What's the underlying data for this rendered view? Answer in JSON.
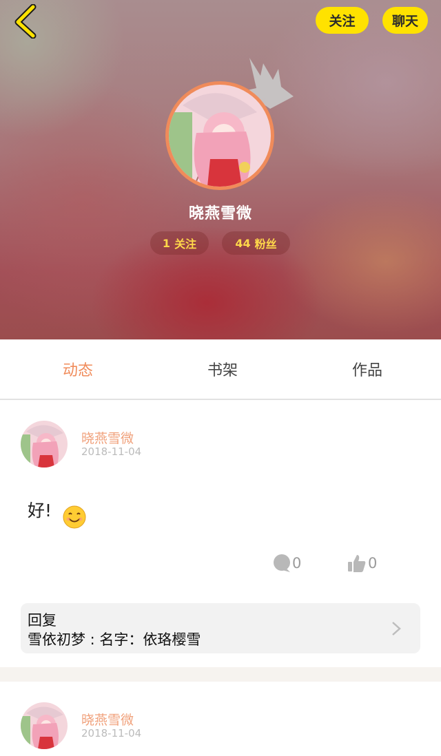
{
  "header": {
    "follow_label": "关注",
    "chat_label": "聊天",
    "username": "晓燕雪微",
    "following_count": "1",
    "following_label": "关注",
    "fans_count": "44",
    "fans_label": "粉丝"
  },
  "tabs": [
    {
      "label": "动态",
      "active": true
    },
    {
      "label": "书架",
      "active": false
    },
    {
      "label": "作品",
      "active": false
    }
  ],
  "posts": [
    {
      "author": "晓燕雪微",
      "date": "2018-11-04",
      "content": "好!",
      "comment_count": "0",
      "like_count": "0",
      "reply": {
        "title": "回复",
        "text": "雪依初梦 : 名字：依珞樱雪"
      }
    },
    {
      "author": "晓燕雪微",
      "date": "2018-11-04"
    }
  ],
  "colors": {
    "accent": "#f08b5a",
    "button": "#ffe200",
    "stat_text": "#ffd84a"
  }
}
